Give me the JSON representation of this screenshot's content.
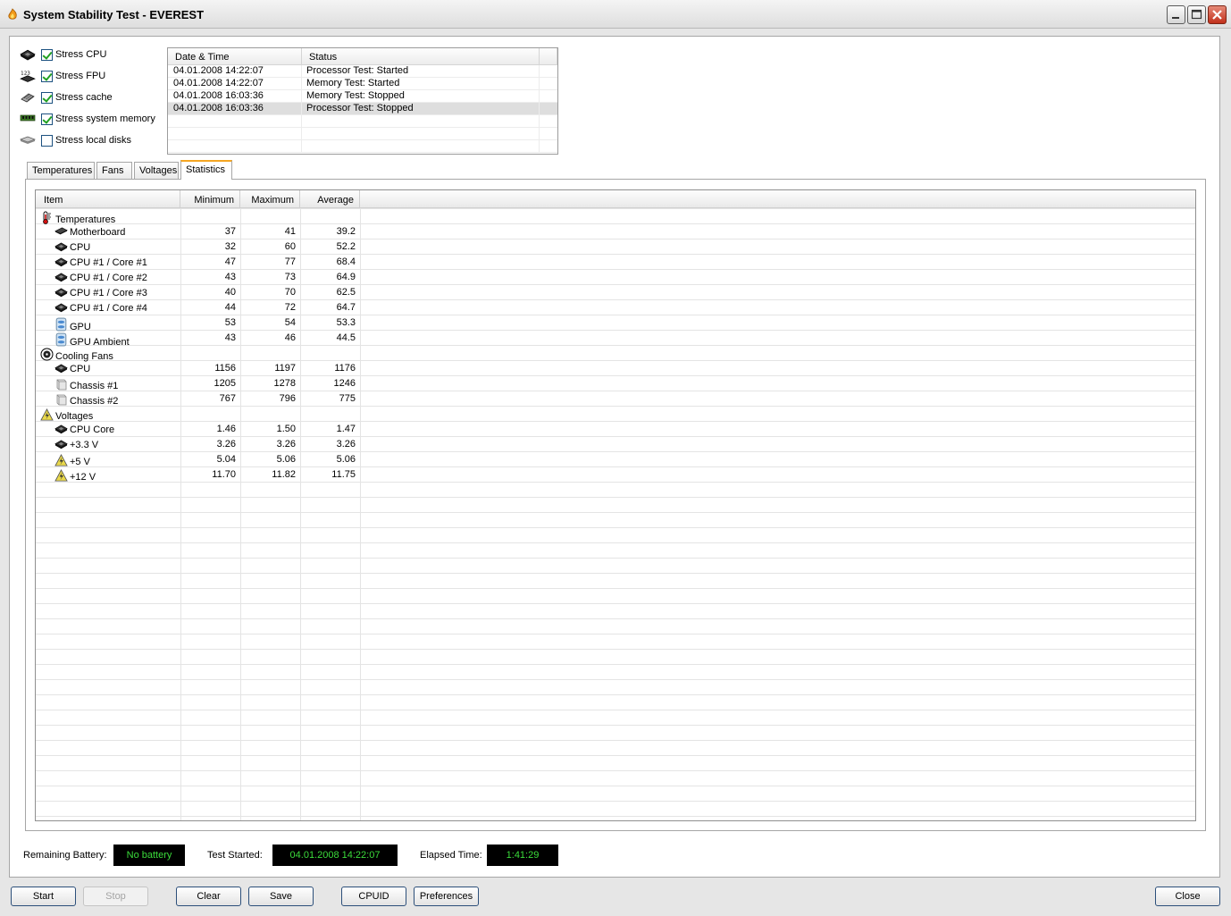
{
  "window": {
    "title": "System Stability Test - EVEREST"
  },
  "stress_options": [
    {
      "label": "Stress CPU",
      "checked": true,
      "icon": "cpu-chip-icon"
    },
    {
      "label": "Stress FPU",
      "checked": true,
      "icon": "fpu-chip-icon"
    },
    {
      "label": "Stress cache",
      "checked": true,
      "icon": "cache-icon"
    },
    {
      "label": "Stress system memory",
      "checked": true,
      "icon": "memory-module-icon"
    },
    {
      "label": "Stress local disks",
      "checked": false,
      "icon": "hard-disk-icon"
    }
  ],
  "log": {
    "columns": [
      "Date & Time",
      "Status"
    ],
    "rows": [
      {
        "datetime": "04.01.2008 14:22:07",
        "status": "Processor Test: Started",
        "selected": false
      },
      {
        "datetime": "04.01.2008 14:22:07",
        "status": "Memory Test: Started",
        "selected": false
      },
      {
        "datetime": "04.01.2008 16:03:36",
        "status": "Memory Test: Stopped",
        "selected": false
      },
      {
        "datetime": "04.01.2008 16:03:36",
        "status": "Processor Test: Stopped",
        "selected": true
      }
    ]
  },
  "tabs": [
    {
      "label": "Temperatures",
      "active": false
    },
    {
      "label": "Fans",
      "active": false
    },
    {
      "label": "Voltages",
      "active": false
    },
    {
      "label": "Statistics",
      "active": true
    }
  ],
  "statistics": {
    "columns": [
      "Item",
      "Minimum",
      "Maximum",
      "Average"
    ],
    "rows": [
      {
        "group": true,
        "item": "Temperatures",
        "icon": "thermometer-icon"
      },
      {
        "item": "Motherboard",
        "min": "37",
        "max": "41",
        "avg": "39.2",
        "icon": "motherboard-icon"
      },
      {
        "item": "CPU",
        "min": "32",
        "max": "60",
        "avg": "52.2",
        "icon": "cpu-chip-icon"
      },
      {
        "item": "CPU #1 / Core #1",
        "min": "47",
        "max": "77",
        "avg": "68.4",
        "icon": "cpu-chip-icon"
      },
      {
        "item": "CPU #1 / Core #2",
        "min": "43",
        "max": "73",
        "avg": "64.9",
        "icon": "cpu-chip-icon"
      },
      {
        "item": "CPU #1 / Core #3",
        "min": "40",
        "max": "70",
        "avg": "62.5",
        "icon": "cpu-chip-icon"
      },
      {
        "item": "CPU #1 / Core #4",
        "min": "44",
        "max": "72",
        "avg": "64.7",
        "icon": "cpu-chip-icon"
      },
      {
        "item": "GPU",
        "min": "53",
        "max": "54",
        "avg": "53.3",
        "icon": "gpu-icon"
      },
      {
        "item": "GPU Ambient",
        "min": "43",
        "max": "46",
        "avg": "44.5",
        "icon": "gpu-icon"
      },
      {
        "group": true,
        "item": "Cooling Fans",
        "icon": "fan-icon"
      },
      {
        "item": "CPU",
        "min": "1156",
        "max": "1197",
        "avg": "1176",
        "icon": "cpu-chip-icon"
      },
      {
        "item": "Chassis #1",
        "min": "1205",
        "max": "1278",
        "avg": "1246",
        "icon": "chassis-icon"
      },
      {
        "item": "Chassis #2",
        "min": "767",
        "max": "796",
        "avg": "775",
        "icon": "chassis-icon"
      },
      {
        "group": true,
        "item": "Voltages",
        "icon": "voltage-warning-icon"
      },
      {
        "item": "CPU Core",
        "min": "1.46",
        "max": "1.50",
        "avg": "1.47",
        "icon": "cpu-chip-icon"
      },
      {
        "item": "+3.3 V",
        "min": "3.26",
        "max": "3.26",
        "avg": "3.26",
        "icon": "cpu-chip-icon"
      },
      {
        "item": "+5 V",
        "min": "5.04",
        "max": "5.06",
        "avg": "5.06",
        "icon": "voltage-warning-icon"
      },
      {
        "item": "+12 V",
        "min": "11.70",
        "max": "11.82",
        "avg": "11.75",
        "icon": "voltage-warning-icon"
      }
    ]
  },
  "status_bar": {
    "battery_label": "Remaining Battery:",
    "battery_value": "No battery",
    "started_label": "Test Started:",
    "started_value": "04.01.2008 14:22:07",
    "elapsed_label": "Elapsed Time:",
    "elapsed_value": "1:41:29",
    "lcd_text_color": "#3bdc3b"
  },
  "buttons": {
    "start": "Start",
    "stop": "Stop",
    "clear": "Clear",
    "save": "Save",
    "cpuid": "CPUID",
    "preferences": "Preferences",
    "close": "Close"
  }
}
